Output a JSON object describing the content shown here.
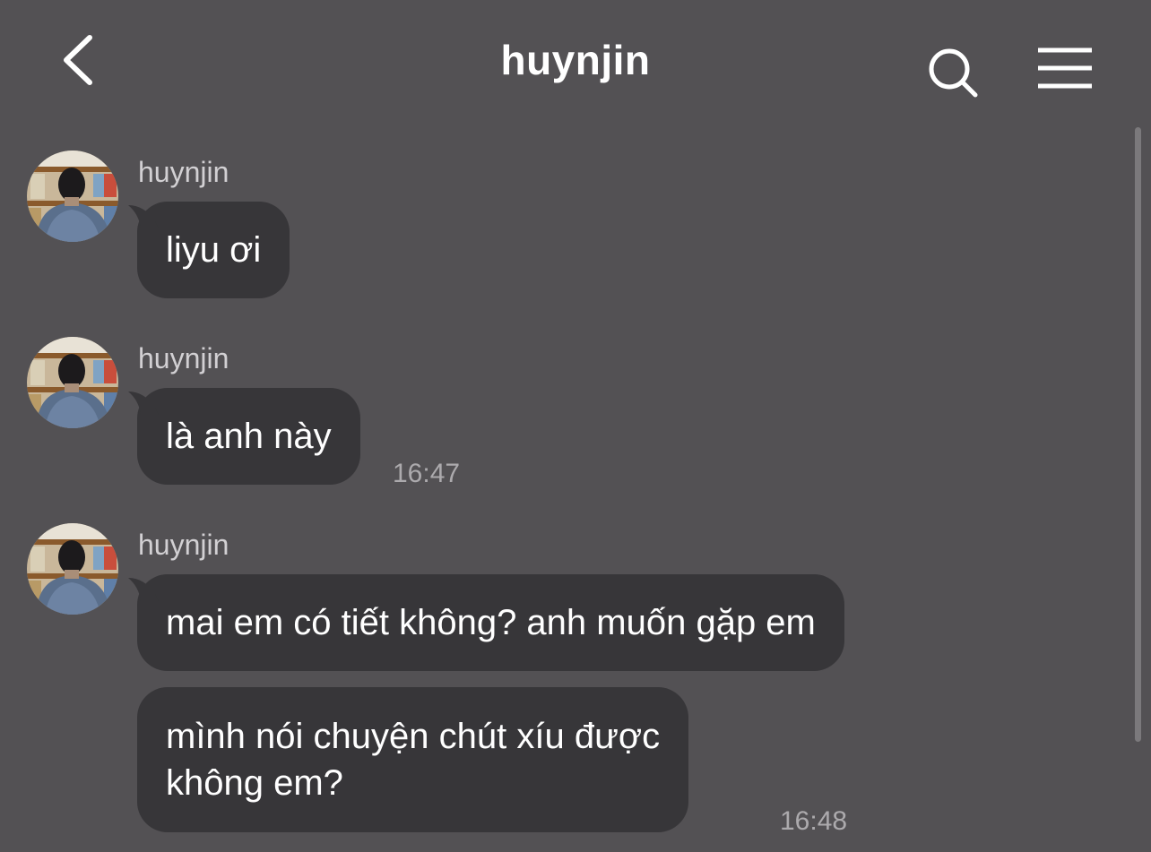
{
  "header": {
    "title": "huynjin",
    "back_icon": "chevron-left-icon",
    "search_icon": "search-icon",
    "menu_icon": "hamburger-menu-icon"
  },
  "colors": {
    "background": "#535154",
    "bubble": "#373639",
    "sender": "#d2d0d3",
    "timestamp": "#acaaad"
  },
  "messages": [
    {
      "sender": "huynjin",
      "text": "liyu ơi",
      "time": ""
    },
    {
      "sender": "huynjin",
      "text": "là anh này",
      "time": "16:47"
    },
    {
      "sender": "huynjin",
      "text": "mai em có tiết không? anh muốn gặp em",
      "time": ""
    },
    {
      "sender": "",
      "text": "mình nói chuyện chút xíu được\nkhông em?",
      "time": "16:48"
    }
  ]
}
